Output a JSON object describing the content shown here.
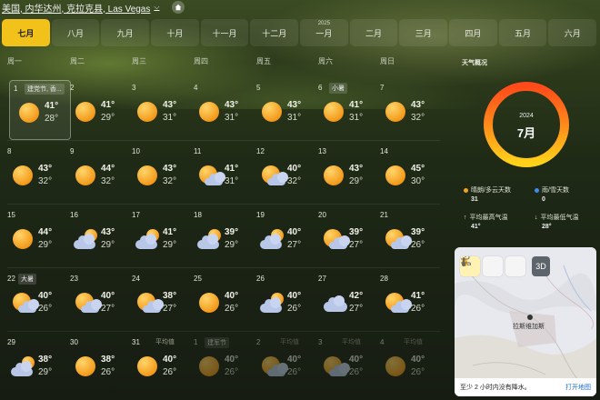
{
  "header": {
    "location": "美国, 内华达州, 克拉克县, Las Vegas",
    "home_icon": "home-icon"
  },
  "months": [
    {
      "label": "七月",
      "active": true
    },
    {
      "label": "八月"
    },
    {
      "label": "九月"
    },
    {
      "label": "十月"
    },
    {
      "label": "十一月"
    },
    {
      "label": "十二月"
    },
    {
      "label": "一月",
      "year": "2025"
    },
    {
      "label": "二月"
    },
    {
      "label": "三月"
    },
    {
      "label": "四月"
    },
    {
      "label": "五月"
    },
    {
      "label": "六月"
    }
  ],
  "weekdays": [
    "周一",
    "周二",
    "周三",
    "周四",
    "周五",
    "周六",
    "周日"
  ],
  "days": [
    {
      "d": "1",
      "hi": "41°",
      "lo": "28°",
      "icon": "sun",
      "label": "建党节, 香..."
    },
    {
      "d": "2",
      "hi": "41°",
      "lo": "29°",
      "icon": "sun"
    },
    {
      "d": "3",
      "hi": "43°",
      "lo": "31°",
      "icon": "sun"
    },
    {
      "d": "4",
      "hi": "43°",
      "lo": "31°",
      "icon": "sun"
    },
    {
      "d": "5",
      "hi": "43°",
      "lo": "31°",
      "icon": "sun"
    },
    {
      "d": "6",
      "hi": "41°",
      "lo": "31°",
      "icon": "sun",
      "label": "小暑"
    },
    {
      "d": "7",
      "hi": "43°",
      "lo": "32°",
      "icon": "sun"
    },
    {
      "d": "8",
      "hi": "43°",
      "lo": "32°",
      "icon": "sun"
    },
    {
      "d": "9",
      "hi": "44°",
      "lo": "32°",
      "icon": "sun"
    },
    {
      "d": "10",
      "hi": "43°",
      "lo": "32°",
      "icon": "sun"
    },
    {
      "d": "11",
      "hi": "41°",
      "lo": "31°",
      "icon": "sun-cloud"
    },
    {
      "d": "12",
      "hi": "40°",
      "lo": "32°",
      "icon": "sun-cloud"
    },
    {
      "d": "13",
      "hi": "43°",
      "lo": "29°",
      "icon": "sun"
    },
    {
      "d": "14",
      "hi": "45°",
      "lo": "30°",
      "icon": "sun"
    },
    {
      "d": "15",
      "hi": "44°",
      "lo": "29°",
      "icon": "sun"
    },
    {
      "d": "16",
      "hi": "43°",
      "lo": "29°",
      "icon": "cloud-sun"
    },
    {
      "d": "17",
      "hi": "41°",
      "lo": "29°",
      "icon": "cloud-sun"
    },
    {
      "d": "18",
      "hi": "39°",
      "lo": "29°",
      "icon": "cloud-sun"
    },
    {
      "d": "19",
      "hi": "40°",
      "lo": "27°",
      "icon": "cloud-sun"
    },
    {
      "d": "20",
      "hi": "39°",
      "lo": "27°",
      "icon": "sun-cloud"
    },
    {
      "d": "21",
      "hi": "39°",
      "lo": "26°",
      "icon": "sun-cloud"
    },
    {
      "d": "22",
      "hi": "40°",
      "lo": "26°",
      "icon": "sun-cloud",
      "label": "大暑"
    },
    {
      "d": "23",
      "hi": "40°",
      "lo": "27°",
      "icon": "sun-cloud"
    },
    {
      "d": "24",
      "hi": "38°",
      "lo": "27°",
      "icon": "sun-cloud"
    },
    {
      "d": "25",
      "hi": "40°",
      "lo": "26°",
      "icon": "sun"
    },
    {
      "d": "26",
      "hi": "40°",
      "lo": "26°",
      "icon": "cloud-sun"
    },
    {
      "d": "27",
      "hi": "42°",
      "lo": "27°",
      "icon": "cloud"
    },
    {
      "d": "28",
      "hi": "41°",
      "lo": "26°",
      "icon": "sun-cloud"
    },
    {
      "d": "29",
      "hi": "38°",
      "lo": "29°",
      "icon": "cloud-sun"
    },
    {
      "d": "30",
      "hi": "38°",
      "lo": "26°",
      "icon": "sun"
    },
    {
      "d": "31",
      "hi": "40°",
      "lo": "26°",
      "icon": "sun",
      "avg": "平均值"
    },
    {
      "d": "1",
      "hi": "40°",
      "lo": "26°",
      "icon": "sun",
      "label": "建军节",
      "dim": true
    },
    {
      "d": "2",
      "hi": "40°",
      "lo": "26°",
      "icon": "sun-cloud",
      "avg": "平均值",
      "dim": true
    },
    {
      "d": "3",
      "hi": "40°",
      "lo": "26°",
      "icon": "sun-cloud",
      "avg": "平均值",
      "dim": true
    },
    {
      "d": "4",
      "hi": "40°",
      "lo": "26°",
      "icon": "sun",
      "avg": "平均值",
      "dim": true
    }
  ],
  "side": {
    "title": "天气概况",
    "year": "2024",
    "month": "7月",
    "stats": [
      {
        "label": "晴朗/多云天数",
        "value": "31",
        "color": "#f2a41a"
      },
      {
        "label": "雨/雪天数",
        "value": "0",
        "color": "#3d8ee8"
      },
      {
        "label": "平均最高气温",
        "value": "41°",
        "icon": "up-arrow-icon"
      },
      {
        "label": "平均最低气温",
        "value": "28°",
        "icon": "down-arrow-icon"
      }
    ]
  },
  "map": {
    "tools": [
      "rain-drop-icon",
      "thermometer-icon",
      "wind-icon"
    ],
    "mode_3d": "3D",
    "city": "拉斯维加斯",
    "footer_text": "至少 2 小时内没有降水。",
    "open_link": "打开地图"
  }
}
